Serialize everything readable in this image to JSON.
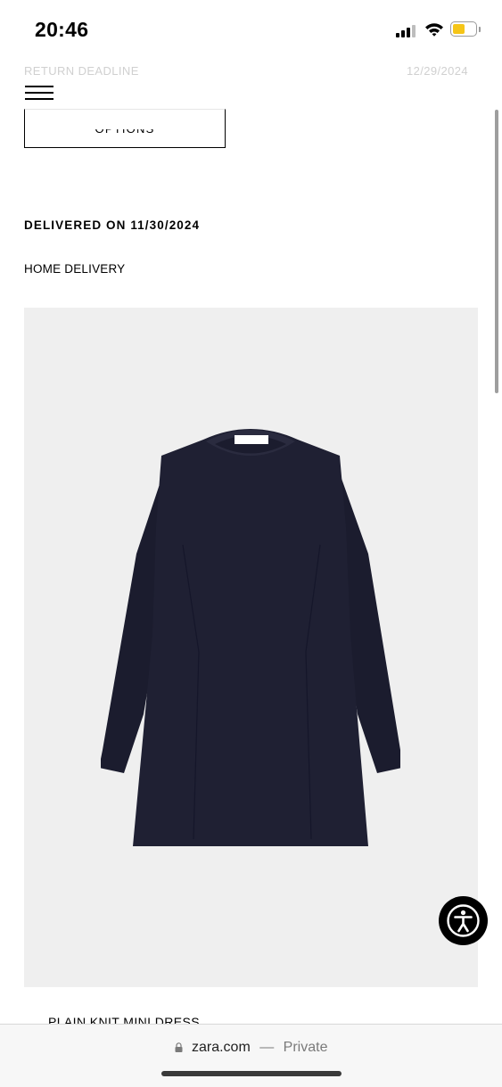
{
  "status_bar": {
    "time": "20:46"
  },
  "faded_header": {
    "label": "RETURN DEADLINE",
    "date": "12/29/2024"
  },
  "options_button": {
    "label": "OPTIONS"
  },
  "order": {
    "delivered_label": "DELIVERED ON 11/30/2024",
    "delivery_type": "HOME DELIVERY"
  },
  "product": {
    "name": "PLAIN KNIT MINI DRESS",
    "image_alt": "dress"
  },
  "browser": {
    "url": "zara.com",
    "separator": "—",
    "mode": "Private"
  },
  "colors": {
    "accent": "#000000",
    "battery": "#f5c518",
    "image_bg": "#efefef",
    "garment": "#1b1c2e"
  },
  "icons": [
    "menu-icon",
    "lock-icon",
    "accessibility-icon",
    "wifi-icon",
    "signal-icon",
    "battery-icon"
  ]
}
